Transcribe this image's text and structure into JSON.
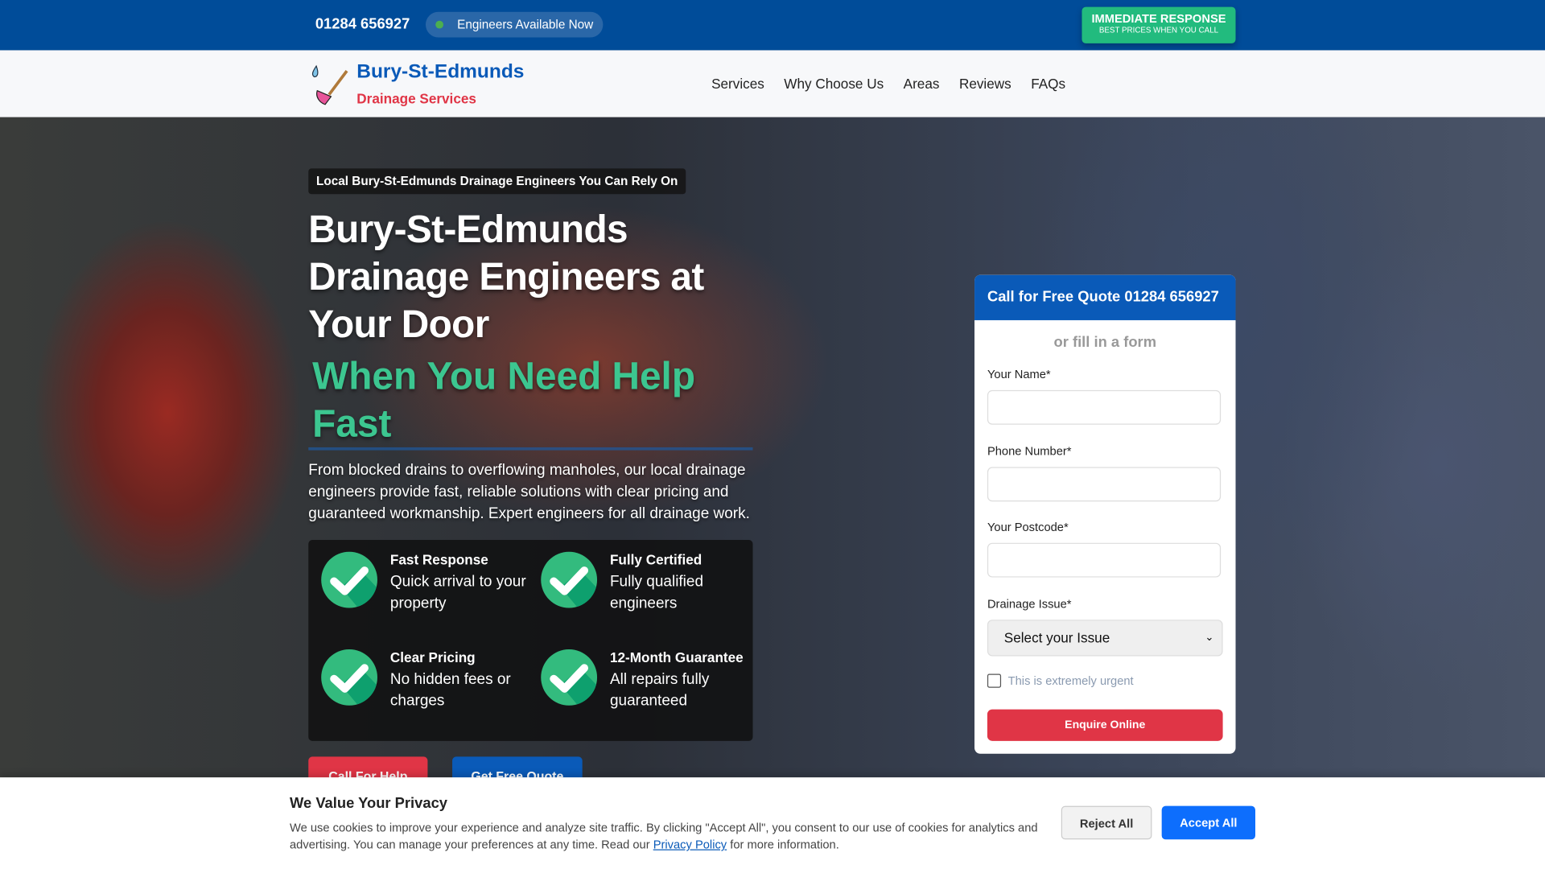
{
  "topbar": {
    "phone": "01284 656927",
    "availability": "Engineers Available Now",
    "cta_title": "IMMEDIATE RESPONSE",
    "cta_sub": "BEST PRICES WHEN YOU CALL"
  },
  "nav": {
    "brand": "Bury-St-Edmunds",
    "subtitle": "Drainage Services",
    "items": [
      "Services",
      "Why Choose Us",
      "Areas",
      "Reviews",
      "FAQs"
    ]
  },
  "hero": {
    "tag": "Local Bury-St-Edmunds Drainage Engineers You Can Rely On",
    "title": "Bury-St-Edmunds Drainage Engineers at Your Door",
    "subtitle": "When You Need Help Fast",
    "description": "From blocked drains to overflowing manholes, our local drainage engineers provide fast, reliable solutions with clear pricing and guaranteed workmanship. Expert engineers for all drainage work.",
    "features": [
      {
        "title": "Fast Response",
        "text": "Quick arrival to your property"
      },
      {
        "title": "Fully Certified",
        "text": "Fully qualified engineers"
      },
      {
        "title": "Clear Pricing",
        "text": "No hidden fees or charges"
      },
      {
        "title": "12-Month Guarantee",
        "text": "All repairs fully guaranteed"
      }
    ],
    "call_button": "Call For Help",
    "quote_button": "Get Free Quote"
  },
  "form": {
    "header": "Call for Free Quote 01284 656927",
    "or_text": "or fill in a form",
    "name_label": "Your Name*",
    "phone_label": "Phone Number*",
    "postcode_label": "Your Postcode*",
    "issue_label": "Drainage Issue*",
    "issue_selected": "Select your Issue",
    "urgent_label": "This is extremely urgent",
    "submit": "Enquire Online"
  },
  "cookie": {
    "title": "We Value Your Privacy",
    "text_before": "We use cookies to improve your experience and analyze site traffic. By clicking \"Accept All\", you consent to our use of cookies for analytics and advertising. You can manage your preferences at any time. Read our ",
    "link": "Privacy Policy",
    "text_after": " for more information.",
    "reject": "Reject All",
    "accept": "Accept All"
  }
}
